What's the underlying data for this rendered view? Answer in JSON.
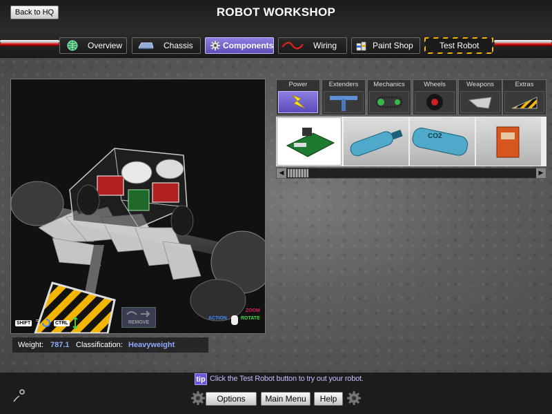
{
  "header": {
    "back_label": "Back to HQ",
    "title": "ROBOT WORKSHOP"
  },
  "tabs": [
    {
      "label": "Overview",
      "icon": "globe-icon"
    },
    {
      "label": "Chassis",
      "icon": "chassis-icon"
    },
    {
      "label": "Components",
      "icon": "gear-icon",
      "active": true
    },
    {
      "label": "Wiring",
      "icon": "wire-icon"
    },
    {
      "label": "Paint Shop",
      "icon": "paint-cans-icon"
    },
    {
      "label": "Test Robot",
      "icon": "",
      "style": "hazard-stripes"
    }
  ],
  "part_categories": [
    {
      "label": "Power",
      "icon": "lightning-bolt-icon",
      "active": true
    },
    {
      "label": "Extenders",
      "icon": "t-connector-icon"
    },
    {
      "label": "Mechanics",
      "icon": "chain-drive-icon"
    },
    {
      "label": "Wheels",
      "icon": "wheel-icon"
    },
    {
      "label": "Weapons",
      "icon": "blade-icon"
    },
    {
      "label": "Extras",
      "icon": "wedge-icon"
    }
  ],
  "part_items": [
    {
      "icon": "circuit-board-icon",
      "selected": true,
      "text": ""
    },
    {
      "icon": "gas-tank-icon",
      "text": ""
    },
    {
      "icon": "co2-tank-icon",
      "text": "CO2"
    },
    {
      "icon": "battery-box-icon",
      "text": ""
    }
  ],
  "preview": {
    "shift_key": "SHIFT",
    "ctrl_key": "CTRL",
    "remove_label": "REMOVE",
    "zoom_label": "ZOOM",
    "action_label": "ACTION",
    "rotate_label": "ROTATE"
  },
  "status": {
    "weight_label": "Weight:",
    "weight_value": "787.1",
    "class_label": "Classification:",
    "class_value": "Heavyweight"
  },
  "tip": {
    "badge": "tip",
    "text": "Click the Test Robot button to try out your robot."
  },
  "footer": {
    "options": "Options",
    "main_menu": "Main Menu",
    "help": "Help"
  },
  "colors": {
    "accent": "#6b5ad6",
    "value_text": "#8fa8ff",
    "hazard_yellow": "#f2b600"
  }
}
